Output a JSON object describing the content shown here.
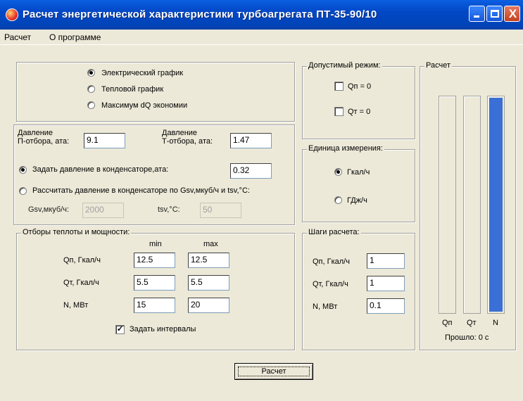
{
  "window": {
    "title": "Расчет энергетической характеристики турбоагрегата ПТ-35-90/10",
    "close_glyph": "X"
  },
  "menu": [
    "Расчет",
    "О программе"
  ],
  "mode": {
    "options": [
      "Электрический график",
      "Тепловой график",
      "Максимум dQ экономии"
    ],
    "selected": 0
  },
  "pressure": {
    "p_extraction_label": "Давление\nП-отбора, ата:",
    "p_extraction_value": "9.1",
    "t_extraction_label": "Давление\nТ-отбора, ата:",
    "t_extraction_value": "1.47",
    "set_condenser_label": "Задать давление в конденсаторе,ата:",
    "set_condenser_selected": true,
    "condenser_value": "0.32",
    "calc_condenser_label": "Рассчитать давление в конденсаторе по Gsv,мкуб/ч и tsv,°C:",
    "calc_condenser_selected": false,
    "gsv_label": "Gsv,мкуб/ч:",
    "gsv_value": "2000",
    "tsv_label": "tsv,°C:",
    "tsv_value": "50"
  },
  "extractions": {
    "legend": "Отборы теплоты и мощности:",
    "min_label": "min",
    "max_label": "max",
    "rows": [
      {
        "label": "Qп, Гкал/ч",
        "min": "12.5",
        "max": "12.5"
      },
      {
        "label": "Qт, Гкал/ч",
        "min": "5.5",
        "max": "5.5"
      },
      {
        "label": "N, МВт",
        "min": "15",
        "max": "20"
      }
    ],
    "intervals_label": "Задать интервалы",
    "intervals_checked": true,
    "check_glyph": "✓"
  },
  "allowed": {
    "legend": "Допустимый режим:",
    "items": [
      {
        "label": "Qп = 0",
        "checked": false
      },
      {
        "label": "Qт = 0",
        "checked": false
      }
    ]
  },
  "units": {
    "legend": "Единица измерения:",
    "options": [
      "Гкал/ч",
      "ГДж/ч"
    ],
    "selected": 0
  },
  "steps": {
    "legend": "Шаги расчета:",
    "rows": [
      {
        "label": "Qп, Гкал/ч",
        "value": "1"
      },
      {
        "label": "Qт, Гкал/ч",
        "value": "1"
      },
      {
        "label": "N, МВт",
        "value": "0.1"
      }
    ]
  },
  "progress": {
    "legend": "Расчет",
    "bars": [
      {
        "label": "Qп",
        "fill": 0
      },
      {
        "label": "Qт",
        "fill": 0
      },
      {
        "label": "N",
        "fill": 1.0
      }
    ],
    "elapsed": "Прошло:  0 с"
  },
  "run_button": "Расчет",
  "colors": {
    "titlebar": "#0248c6",
    "progress_fill": "#3a6fd6",
    "window_bg": "#ece9d8"
  }
}
